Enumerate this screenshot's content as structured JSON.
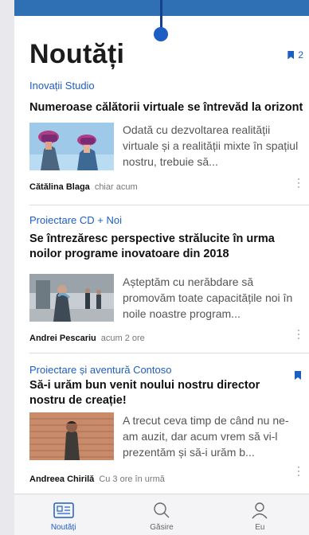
{
  "header": {
    "title": "Noutăți",
    "saved_count": "2"
  },
  "articles": [
    {
      "category": "Inovații Studio",
      "headline": "Numeroase călătorii virtuale se întrevăd la orizont",
      "summary": "Odată cu dezvoltarea realității virtuale și a realității mixte în spațiul nostru, trebuie să...",
      "author": "Cătălina Blaga",
      "time": "chiar acum",
      "bookmarked": false
    },
    {
      "category": "Proiectare CD + Noi",
      "headline": "Se întrezăresc perspective strălucite în urma noilor programe inovatoare din 2018",
      "summary": "Așteptăm cu nerăbdare să promovăm toate capacitățile noi în noile noastre program...",
      "author": "Andrei Pescariu",
      "time": "acum 2 ore",
      "bookmarked": false
    },
    {
      "category": "Proiectare și aventură Contoso",
      "headline": "Să-i urăm bun venit noului nostru director nostru de creație!",
      "summary": "A trecut ceva timp de când nu ne-am auzit, dar acum vrem să vi-l prezentăm și să-i urăm b...",
      "author": "Andreea Chirilă",
      "time": "Cu 3 ore în urmă",
      "bookmarked": true
    }
  ],
  "tabs": [
    {
      "label": "Noutăți",
      "icon": "news-icon",
      "active": true
    },
    {
      "label": "Găsire",
      "icon": "search-icon",
      "active": false
    },
    {
      "label": "Eu",
      "icon": "person-icon",
      "active": false
    }
  ],
  "colors": {
    "accent": "#1d5ec4",
    "top_bar": "#2f6fb3"
  }
}
